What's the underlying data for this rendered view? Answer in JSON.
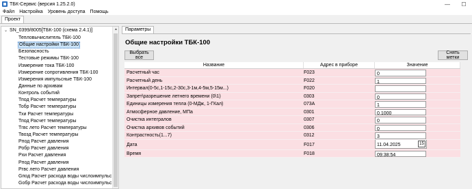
{
  "window": {
    "title": "ТБК-Сервис (версия 1.25.2.0)",
    "minimize": "—",
    "maximize": "☐"
  },
  "menu": [
    "Файл",
    "Настройка",
    "Уровень доступа",
    "Помощь"
  ],
  "project_tab": "Проект",
  "tree": {
    "root": "SN_0399/8005[ТБК-100 (схема 2.4.1)]",
    "selected_index": 1,
    "items": [
      "Тепловычислитель ТБК-100",
      "Общие настройки ТБК-100",
      "Безопасность",
      "Тестовые режимы ТБК-100",
      "Измерение тока ТБК-100",
      "Измерение сопротивления  ТБК-100",
      "Измерения импульсные ТБК-100",
      "Данные по архивам",
      "Контроль событий",
      "Тпод Расчет температуры",
      "Тобр Расчет температуры",
      "Тхи Расчет температуры",
      "Тпод Расчет температуры",
      "Тгвс лето Расчет температуры",
      "Твозд Расчет температуры",
      "Рпод Расчет давления",
      "Робр Расчет давления",
      "Рхи Расчет давления",
      "Рпод Расчет давления",
      "Ргвс лето Расчет давления",
      "Gпод Расчет расхода воды числоимпульс датч",
      "Gобр Расчет расхода воды числоимпульс датч"
    ]
  },
  "panel": {
    "tab": "Параметры",
    "title": "Общие настройки ТБК-100",
    "select_all": "Выбрать все",
    "clear_marks": "Снять метки",
    "columns": [
      "Название",
      "Адрес в приборе",
      "Значение"
    ],
    "rows": [
      {
        "name": "Расчетный час",
        "addr": "F023",
        "value": "0"
      },
      {
        "name": "Расчетный день",
        "addr": "F022",
        "value": "1"
      },
      {
        "name": "Интервал(0-5с,1-15с,2-30с,3-1м,4-5м,5-15м...)",
        "addr": "F020",
        "value": ""
      },
      {
        "name": "Запрет\\разрешение летнего времени (0\\1)",
        "addr": "0303",
        "value": "0"
      },
      {
        "name": "Единицы измерения тепла (0-МДж, 1-ГКал)",
        "addr": "073A",
        "value": "1"
      },
      {
        "name": "Атмосферное давление, МПа",
        "addr": "0301",
        "value": "0,1000"
      },
      {
        "name": "Очистка интегралов",
        "addr": "0307",
        "value": "0"
      },
      {
        "name": "Очистка архивов событий",
        "addr": "0306",
        "value": "0"
      },
      {
        "name": "Контрастность(1...7)",
        "addr": "0312",
        "value": "3"
      },
      {
        "name": "Дата",
        "addr": "F017",
        "value": "11.04.2025",
        "calendar_label": "15"
      },
      {
        "name": "Время",
        "addr": "F018",
        "value": "09:38:54"
      }
    ]
  }
}
